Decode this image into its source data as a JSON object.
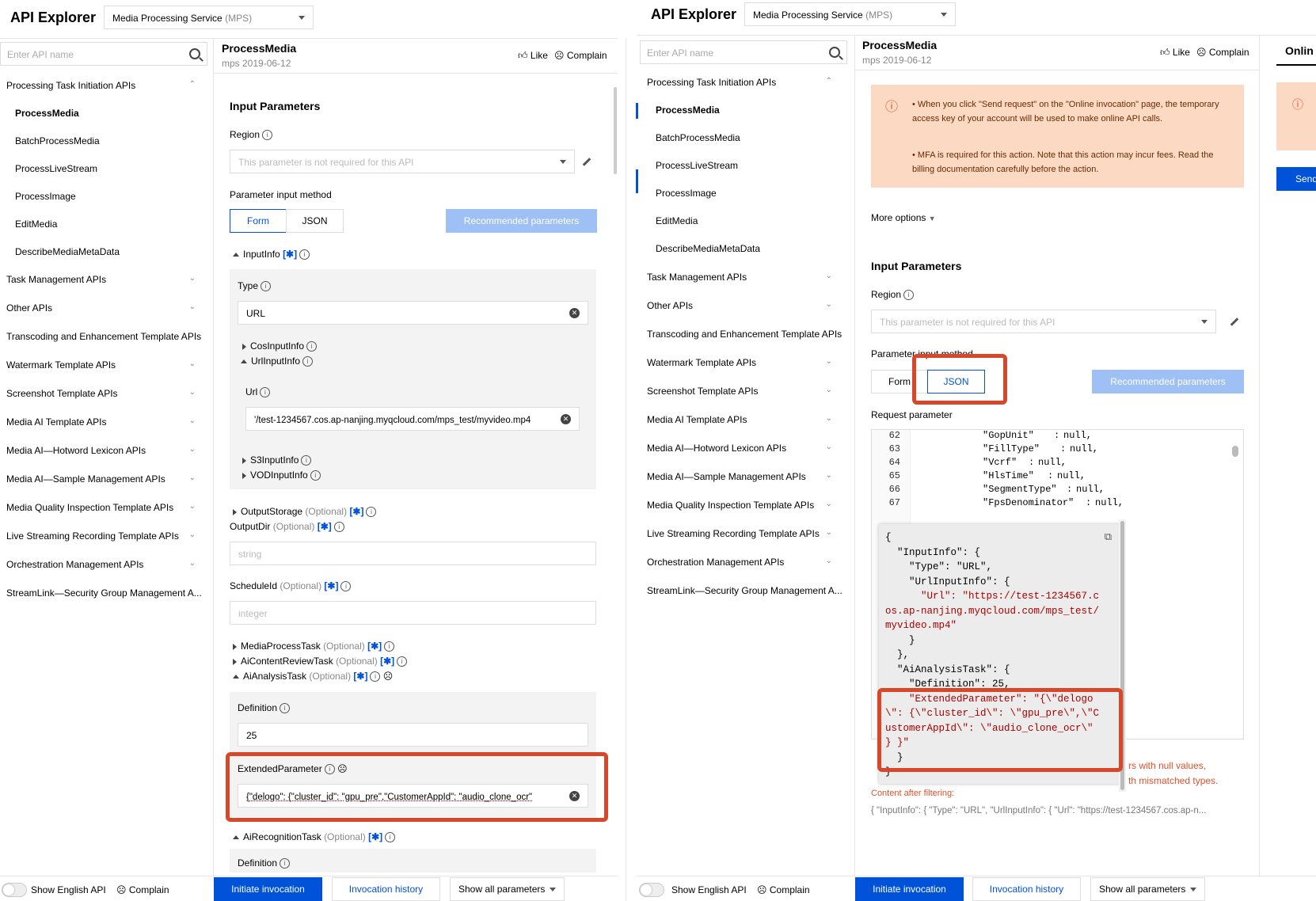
{
  "left": {
    "app_title": "API Explorer",
    "service": {
      "name": "Media Processing Service",
      "abbr": "(MPS)"
    },
    "search_placeholder": "Enter API name",
    "nav": {
      "group1": "Processing Task Initiation APIs",
      "items": [
        "ProcessMedia",
        "BatchProcessMedia",
        "ProcessLiveStream",
        "ProcessImage",
        "EditMedia",
        "DescribeMediaMetaData"
      ],
      "groups": [
        "Task Management APIs",
        "Other APIs",
        "Transcoding and Enhancement Template APIs",
        "Watermark Template APIs",
        "Screenshot Template APIs",
        "Media AI Template APIs",
        "Media AI—Hotword Lexicon APIs",
        "Media AI—Sample Management APIs",
        "Media Quality Inspection Template APIs",
        "Live Streaming Recording Template APIs",
        "Orchestration Management APIs",
        "StreamLink—Security Group Management A..."
      ]
    },
    "header": {
      "title": "ProcessMedia",
      "version": "mps 2019-06-12",
      "like": "Like",
      "complain": "Complain"
    },
    "input_params_title": "Input Parameters",
    "region_label": "Region",
    "region_placeholder": "This parameter is not required for this API",
    "input_method_label": "Parameter input method",
    "tab_form": "Form",
    "tab_json": "JSON",
    "recommended": "Recommended parameters",
    "inputinfo": "InputInfo",
    "type_label": "Type",
    "type_value": "URL",
    "cos_input": "CosInputInfo",
    "url_input": "UrlInputInfo",
    "url_label": "Url",
    "url_value": "'/test-1234567.cos.ap-nanjing.myqcloud.com/mps_test/myvideo.mp4",
    "s3_input": "S3InputInfo",
    "vod_input": "VODInputInfo",
    "output_storage": "OutputStorage",
    "optional": "(Optional)",
    "output_dir": "OutputDir",
    "string_ph": "string",
    "schedule_id": "ScheduleId",
    "integer_ph": "integer",
    "media_process_task": "MediaProcessTask",
    "ai_content_review_task": "AiContentReviewTask",
    "ai_analysis_task": "AiAnalysisTask",
    "definition_label": "Definition",
    "definition_value": "25",
    "extended_label": "ExtendedParameter",
    "extended_value": "{\"delogo\": {\"cluster_id\": \"gpu_pre\",\"CustomerAppId\": \"audio_clone_ocr\"",
    "ai_recognition_task": "AiRecognitionTask",
    "definition_label2": "Definition",
    "footer": {
      "show_english": "Show English API",
      "complain": "Complain",
      "initiate": "Initiate invocation",
      "history": "Invocation history",
      "show_all": "Show all parameters"
    },
    "star": "[✱]"
  },
  "right": {
    "app_title": "API Explorer",
    "service": {
      "name": "Media Processing Service",
      "abbr": "(MPS)"
    },
    "search_placeholder": "Enter API name",
    "header": {
      "title": "ProcessMedia",
      "version": "mps 2019-06-12",
      "like": "Like",
      "complain": "Complain",
      "online_tab": "Onlin"
    },
    "notice1": "When you click \"Send request\" on the \"Online invocation\" page, the temporary access key of your account will be used to make online API calls.",
    "notice2": "MFA is required for this action. Note that this action may incur fees. Read the billing documentation carefully before the action.",
    "more_options": "More options",
    "input_params_title": "Input Parameters",
    "region_label": "Region",
    "region_placeholder": "This parameter is not required for this API",
    "input_method_label": "Parameter input method",
    "tab_form": "Form",
    "tab_json": "JSON",
    "recommended": "Recommended parameters",
    "request_param": "Request parameter",
    "code_lines": [
      {
        "n": "62",
        "k": "\"GopUnit\"",
        "v": "null,"
      },
      {
        "n": "63",
        "k": "\"FillType\"",
        "v": "null,"
      },
      {
        "n": "64",
        "k": "\"Vcrf\"",
        "v": "null,"
      },
      {
        "n": "65",
        "k": "\"HlsTime\"",
        "v": "null,"
      },
      {
        "n": "66",
        "k": "\"SegmentType\"",
        "v": "null,"
      },
      {
        "n": "67",
        "k": "\"FpsDenominator\"",
        "v": "null,"
      }
    ],
    "popup_lines": [
      "{",
      "  \"InputInfo\": {",
      "    \"Type\": \"URL\",",
      "    \"UrlInputInfo\": {",
      "      \"Url\": \"https://test-1234567.c",
      "os.ap-nanjing.myqcloud.com/mps_test/",
      "myvideo.mp4\"",
      "    }",
      "  },",
      "  \"AiAnalysisTask\": {",
      "    \"Definition\": 25,",
      "    \"ExtendedParameter\": \"{\\\"delogo",
      "\\\": {\\\"cluster_id\\\": \\\"gpu_pre\\\",\\\"C",
      "ustomerAppId\\\": \\\"audio_clone_ocr\\\"",
      "} }\"",
      "  }",
      "}"
    ],
    "warn1": "rs with null values,",
    "warn2": "th mismatched types.",
    "content_after": "Content after filtering:",
    "content_after_value": "{ \"InputInfo\": { \"Type\": \"URL\", \"UrlInputInfo\": { \"Url\": \"https://test-1234567.cos.ap-n...",
    "send": "Send",
    "footer": {
      "show_english": "Show English API",
      "complain": "Complain",
      "initiate": "Initiate invocation",
      "history": "Invocation history",
      "show_all": "Show all parameters"
    }
  },
  "colors": {
    "accent": "#0052d9",
    "highlight": "#d9472b",
    "notice_bg": "#fbd9c3"
  }
}
